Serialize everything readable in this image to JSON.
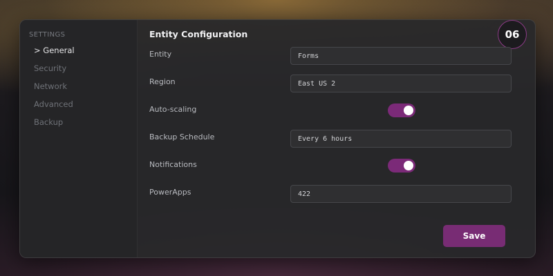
{
  "sidebar": {
    "heading": "SETTINGS",
    "items": [
      {
        "label": "> General",
        "active": true
      },
      {
        "label": "Security",
        "active": false
      },
      {
        "label": "Network",
        "active": false
      },
      {
        "label": "Advanced",
        "active": false
      },
      {
        "label": "Backup",
        "active": false
      }
    ]
  },
  "header": {
    "title": "Entity Configuration",
    "badge": "06"
  },
  "form": {
    "entity": {
      "label": "Entity",
      "value": "Forms"
    },
    "region": {
      "label": "Region",
      "value": "East US 2"
    },
    "auto_scaling": {
      "label": "Auto-scaling",
      "enabled": true
    },
    "backup_schedule": {
      "label": "Backup Schedule",
      "value": "Every 6 hours"
    },
    "notifications": {
      "label": "Notifications",
      "enabled": true
    },
    "powerapps": {
      "label": "PowerApps",
      "value": "422"
    }
  },
  "actions": {
    "save_label": "Save"
  },
  "colors": {
    "accent": "#7b2a78",
    "badge_border": "#8d3b87"
  }
}
